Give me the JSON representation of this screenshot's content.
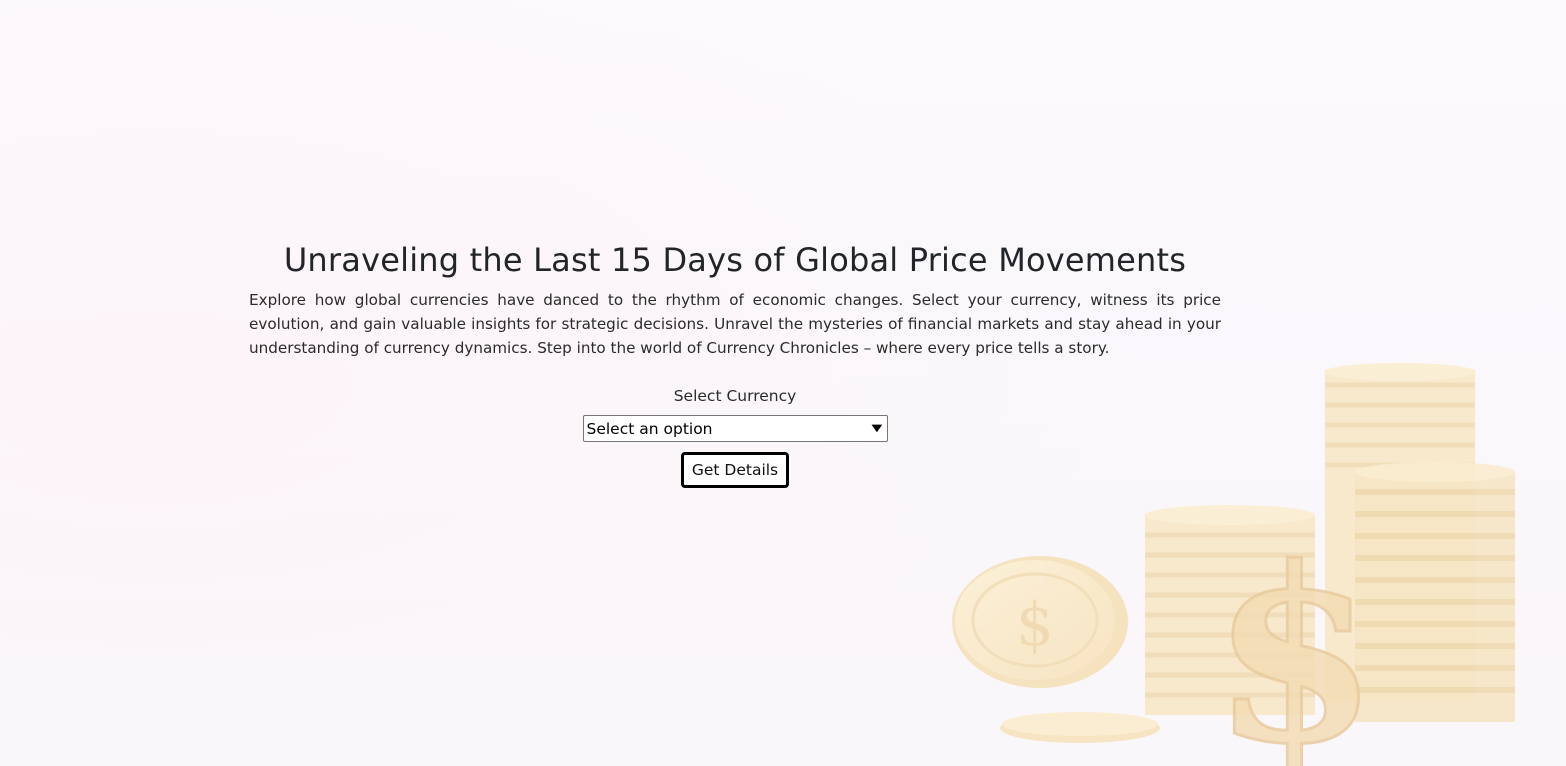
{
  "hero": {
    "title": "Unraveling the Last 15 Days of Global Price Movements",
    "description": "Explore how global currencies have danced to the rhythm of economic changes. Select your currency, witness its price evolution, and gain valuable insights for strategic decisions. Unravel the mysteries of financial markets and stay ahead in your understanding of currency dynamics. Step into the world of Currency Chronicles – where every price tells a story."
  },
  "form": {
    "label": "Select Currency",
    "select_value": "Select an option",
    "button_label": "Get Details"
  },
  "background": {
    "icon": "coin-stack-dollar-illustration",
    "accent_color": "#f2d7a0"
  }
}
